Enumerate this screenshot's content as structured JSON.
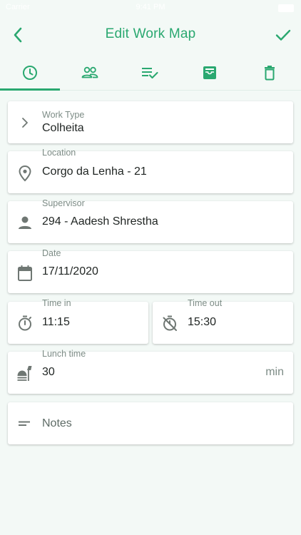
{
  "status_bar": {
    "carrier": "Carrier",
    "time": "9:41 PM"
  },
  "header": {
    "title": "Edit Work Map",
    "back_icon": "chevron-left-icon",
    "confirm_icon": "checkmark-icon"
  },
  "tabs": [
    {
      "icon": "clock-icon",
      "active": true
    },
    {
      "icon": "people-icon",
      "active": false
    },
    {
      "icon": "checklist-icon",
      "active": false
    },
    {
      "icon": "inbox-tray-icon",
      "active": false
    },
    {
      "icon": "trash-icon",
      "active": false
    }
  ],
  "form": {
    "work_type": {
      "label": "Work Type",
      "value": "Colheita"
    },
    "location": {
      "label": "Location",
      "value": "Corgo da Lenha - 21"
    },
    "supervisor": {
      "label": "Supervisor",
      "value": "294 - Aadesh Shrestha"
    },
    "date": {
      "label": "Date",
      "value": "17/11/2020"
    },
    "time_in": {
      "label": "Time in",
      "value": "11:15"
    },
    "time_out": {
      "label": "Time out",
      "value": "15:30"
    },
    "lunch_time": {
      "label": "Lunch time",
      "value": "30",
      "unit": "min"
    },
    "notes": {
      "placeholder": "Notes"
    }
  },
  "colors": {
    "accent": "#2aa870",
    "background": "#f3f9f6",
    "card": "#ffffff",
    "label": "#7d8c86",
    "value": "#1f2422",
    "icon": "#6f7773"
  }
}
